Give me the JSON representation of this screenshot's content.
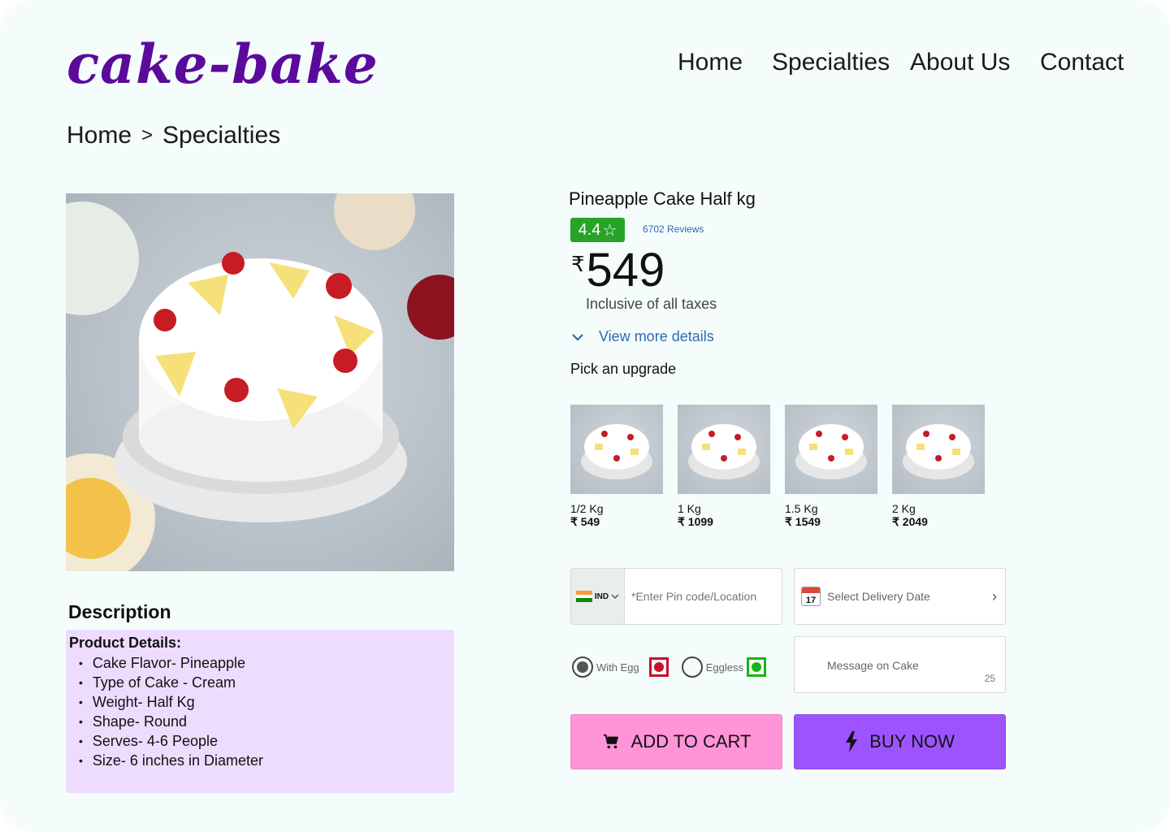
{
  "brand": {
    "logo": "cake-bake",
    "color": "#5b0a9c"
  },
  "nav": {
    "home": "Home",
    "specialties": "Specialties",
    "about": "About Us",
    "contact": "Contact"
  },
  "breadcrumb": {
    "home": "Home",
    "sep": ">",
    "current": "Specialties"
  },
  "description": {
    "title": "Description",
    "heading": "Product Details:",
    "items": [
      "Cake Flavor- Pineapple",
      "Type of Cake - Cream",
      "Weight- Half Kg",
      "Shape- Round",
      "Serves- 4-6 People",
      "Size- 6 inches in Diameter"
    ]
  },
  "product": {
    "title": "Pineapple Cake Half kg",
    "rating": "4.4",
    "reviews": "6702 Reviews",
    "currency": "₹",
    "price": "549",
    "taxes": "Inclusive of all taxes",
    "more_details": "View more details",
    "upgrade_title": "Pick an upgrade"
  },
  "upgrades": [
    {
      "weight": "1/2  Kg",
      "price": "₹ 549"
    },
    {
      "weight": "1 Kg",
      "price": "₹ 1099"
    },
    {
      "weight": "1.5  Kg",
      "price": "₹ 1549"
    },
    {
      "weight": "2  Kg",
      "price": "₹ 2049"
    }
  ],
  "delivery": {
    "country": "IND",
    "pin_placeholder": "*Enter Pin code/Location",
    "date_label": "Select Delivery Date",
    "calendar_day": "17"
  },
  "options": {
    "with_egg": "With Egg",
    "eggless": "Eggless",
    "selected": "With Egg"
  },
  "message": {
    "placeholder": "Message on Cake",
    "max": "25"
  },
  "actions": {
    "add_to_cart": "ADD TO CART",
    "buy_now": "BUY NOW"
  },
  "colors": {
    "background": "#f4fdfb",
    "rating": "#27a327",
    "cart": "#ff94d8",
    "buy": "#9d54ff",
    "desc_box": "#eedcff"
  }
}
